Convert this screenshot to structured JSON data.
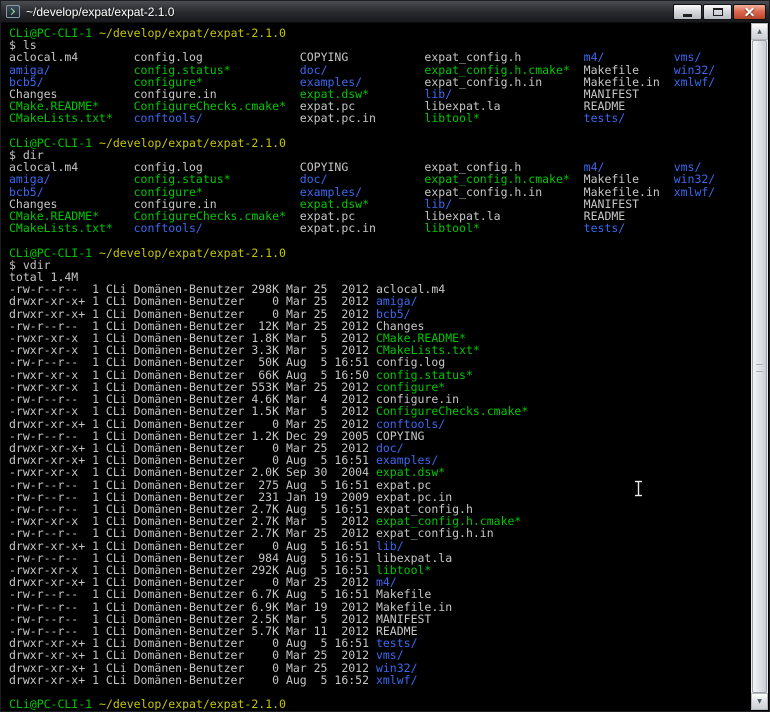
{
  "window": {
    "title": "~/develop/expat/expat-2.1.0"
  },
  "colors": {
    "background": "#000000",
    "plain_text": "#c6c6c6",
    "directory": "#3b68f0",
    "executable": "#00c800",
    "prompt_user": "#00c800",
    "prompt_path": "#c6c600",
    "close_button": "#dd6a50"
  },
  "terminal": {
    "prompt_user": "CLi@PC-CLI-1",
    "prompt_path": "~/develop/expat/expat-2.1.0",
    "sections": [
      {
        "cmd": "$ ls",
        "type": "ls"
      },
      {
        "cmd": "$ dir",
        "type": "ls"
      },
      {
        "cmd": "$ vdir",
        "type": "vdir"
      }
    ],
    "ls_rows": [
      [
        {
          "t": "aclocal.m4",
          "c": "p",
          "w": 18
        },
        {
          "t": "config.log",
          "c": "p",
          "w": 24
        },
        {
          "t": "COPYING",
          "c": "p",
          "w": 18
        },
        {
          "t": "expat_config.h",
          "c": "p",
          "w": 23
        },
        {
          "t": "m4/",
          "c": "d",
          "w": 13
        },
        {
          "t": "vms/",
          "c": "d"
        }
      ],
      [
        {
          "t": "amiga/",
          "c": "d",
          "w": 18
        },
        {
          "t": "config.status*",
          "c": "e",
          "w": 24
        },
        {
          "t": "doc/",
          "c": "d",
          "w": 18
        },
        {
          "t": "expat_config.h.cmake*",
          "c": "e",
          "w": 23
        },
        {
          "t": "Makefile",
          "c": "p",
          "w": 13
        },
        {
          "t": "win32/",
          "c": "d"
        }
      ],
      [
        {
          "t": "bcb5/",
          "c": "d",
          "w": 18
        },
        {
          "t": "configure*",
          "c": "e",
          "w": 24
        },
        {
          "t": "examples/",
          "c": "d",
          "w": 18
        },
        {
          "t": "expat_config.h.in",
          "c": "p",
          "w": 23
        },
        {
          "t": "Makefile.in",
          "c": "p",
          "w": 13
        },
        {
          "t": "xmlwf/",
          "c": "d"
        }
      ],
      [
        {
          "t": "Changes",
          "c": "p",
          "w": 18
        },
        {
          "t": "configure.in",
          "c": "p",
          "w": 24
        },
        {
          "t": "expat.dsw*",
          "c": "e",
          "w": 18
        },
        {
          "t": "lib/",
          "c": "d",
          "w": 23
        },
        {
          "t": "MANIFEST",
          "c": "p",
          "w": 13
        }
      ],
      [
        {
          "t": "CMake.README*",
          "c": "e",
          "w": 18
        },
        {
          "t": "ConfigureChecks.cmake*",
          "c": "e",
          "w": 24
        },
        {
          "t": "expat.pc",
          "c": "p",
          "w": 18
        },
        {
          "t": "libexpat.la",
          "c": "p",
          "w": 23
        },
        {
          "t": "README",
          "c": "p",
          "w": 13
        }
      ],
      [
        {
          "t": "CMakeLists.txt*",
          "c": "e",
          "w": 18
        },
        {
          "t": "conftools/",
          "c": "d",
          "w": 24
        },
        {
          "t": "expat.pc.in",
          "c": "p",
          "w": 18
        },
        {
          "t": "libtool*",
          "c": "e",
          "w": 23
        },
        {
          "t": "tests/",
          "c": "d",
          "w": 13
        }
      ]
    ],
    "vdir_total": "total 1.4M",
    "vdir_owner": "1 CLi Domänen-Benutzer",
    "vdir_entries": [
      {
        "perm": "-rw-r--r--",
        "size": "298K",
        "date": "Mar 25  2012",
        "name": "aclocal.m4",
        "c": "p"
      },
      {
        "perm": "drwxr-xr-x+",
        "size": "0",
        "date": "Mar 25  2012",
        "name": "amiga/",
        "c": "d"
      },
      {
        "perm": "drwxr-xr-x+",
        "size": "0",
        "date": "Mar 25  2012",
        "name": "bcb5/",
        "c": "d"
      },
      {
        "perm": "-rw-r--r--",
        "size": "12K",
        "date": "Mar 25  2012",
        "name": "Changes",
        "c": "p"
      },
      {
        "perm": "-rwxr-xr-x",
        "size": "1.8K",
        "date": "Mar  5  2012",
        "name": "CMake.README*",
        "c": "e"
      },
      {
        "perm": "-rwxr-xr-x",
        "size": "3.3K",
        "date": "Mar  5  2012",
        "name": "CMakeLists.txt*",
        "c": "e"
      },
      {
        "perm": "-rw-r--r--",
        "size": "50K",
        "date": "Aug  5 16:51",
        "name": "config.log",
        "c": "p"
      },
      {
        "perm": "-rwxr-xr-x",
        "size": "66K",
        "date": "Aug  5 16:50",
        "name": "config.status*",
        "c": "e"
      },
      {
        "perm": "-rwxr-xr-x",
        "size": "553K",
        "date": "Mar 25  2012",
        "name": "configure*",
        "c": "e"
      },
      {
        "perm": "-rw-r--r--",
        "size": "4.6K",
        "date": "Mar  4  2012",
        "name": "configure.in",
        "c": "p"
      },
      {
        "perm": "-rwxr-xr-x",
        "size": "1.5K",
        "date": "Mar  5  2012",
        "name": "ConfigureChecks.cmake*",
        "c": "e"
      },
      {
        "perm": "drwxr-xr-x+",
        "size": "0",
        "date": "Mar 25  2012",
        "name": "conftools/",
        "c": "d"
      },
      {
        "perm": "-rw-r--r--",
        "size": "1.2K",
        "date": "Dec 29  2005",
        "name": "COPYING",
        "c": "p"
      },
      {
        "perm": "drwxr-xr-x+",
        "size": "0",
        "date": "Mar 25  2012",
        "name": "doc/",
        "c": "d"
      },
      {
        "perm": "drwxr-xr-x+",
        "size": "0",
        "date": "Aug  5 16:51",
        "name": "examples/",
        "c": "d"
      },
      {
        "perm": "-rwxr-xr-x",
        "size": "2.0K",
        "date": "Sep 30  2004",
        "name": "expat.dsw*",
        "c": "e"
      },
      {
        "perm": "-rw-r--r--",
        "size": "275",
        "date": "Aug  5 16:51",
        "name": "expat.pc",
        "c": "p"
      },
      {
        "perm": "-rw-r--r--",
        "size": "231",
        "date": "Jan 19  2009",
        "name": "expat.pc.in",
        "c": "p"
      },
      {
        "perm": "-rw-r--r--",
        "size": "2.7K",
        "date": "Aug  5 16:51",
        "name": "expat_config.h",
        "c": "p"
      },
      {
        "perm": "-rwxr-xr-x",
        "size": "2.7K",
        "date": "Mar  5  2012",
        "name": "expat_config.h.cmake*",
        "c": "e"
      },
      {
        "perm": "-rw-r--r--",
        "size": "2.7K",
        "date": "Mar 25  2012",
        "name": "expat_config.h.in",
        "c": "p"
      },
      {
        "perm": "drwxr-xr-x+",
        "size": "0",
        "date": "Aug  5 16:51",
        "name": "lib/",
        "c": "d"
      },
      {
        "perm": "-rw-r--r--",
        "size": "984",
        "date": "Aug  5 16:51",
        "name": "libexpat.la",
        "c": "p"
      },
      {
        "perm": "-rwxr-xr-x",
        "size": "292K",
        "date": "Aug  5 16:51",
        "name": "libtool*",
        "c": "e"
      },
      {
        "perm": "drwxr-xr-x+",
        "size": "0",
        "date": "Mar 25  2012",
        "name": "m4/",
        "c": "d"
      },
      {
        "perm": "-rw-r--r--",
        "size": "6.7K",
        "date": "Aug  5 16:51",
        "name": "Makefile",
        "c": "p"
      },
      {
        "perm": "-rw-r--r--",
        "size": "6.9K",
        "date": "Mar 19  2012",
        "name": "Makefile.in",
        "c": "p"
      },
      {
        "perm": "-rw-r--r--",
        "size": "2.5K",
        "date": "Mar  5  2012",
        "name": "MANIFEST",
        "c": "p"
      },
      {
        "perm": "-rw-r--r--",
        "size": "5.7K",
        "date": "Mar 11  2012",
        "name": "README",
        "c": "p"
      },
      {
        "perm": "drwxr-xr-x+",
        "size": "0",
        "date": "Aug  5 16:51",
        "name": "tests/",
        "c": "d"
      },
      {
        "perm": "drwxr-xr-x+",
        "size": "0",
        "date": "Mar 25  2012",
        "name": "vms/",
        "c": "d"
      },
      {
        "perm": "drwxr-xr-x+",
        "size": "0",
        "date": "Mar 25  2012",
        "name": "win32/",
        "c": "d"
      },
      {
        "perm": "drwxr-xr-x+",
        "size": "0",
        "date": "Aug  5 16:52",
        "name": "xmlwf/",
        "c": "d"
      }
    ]
  }
}
